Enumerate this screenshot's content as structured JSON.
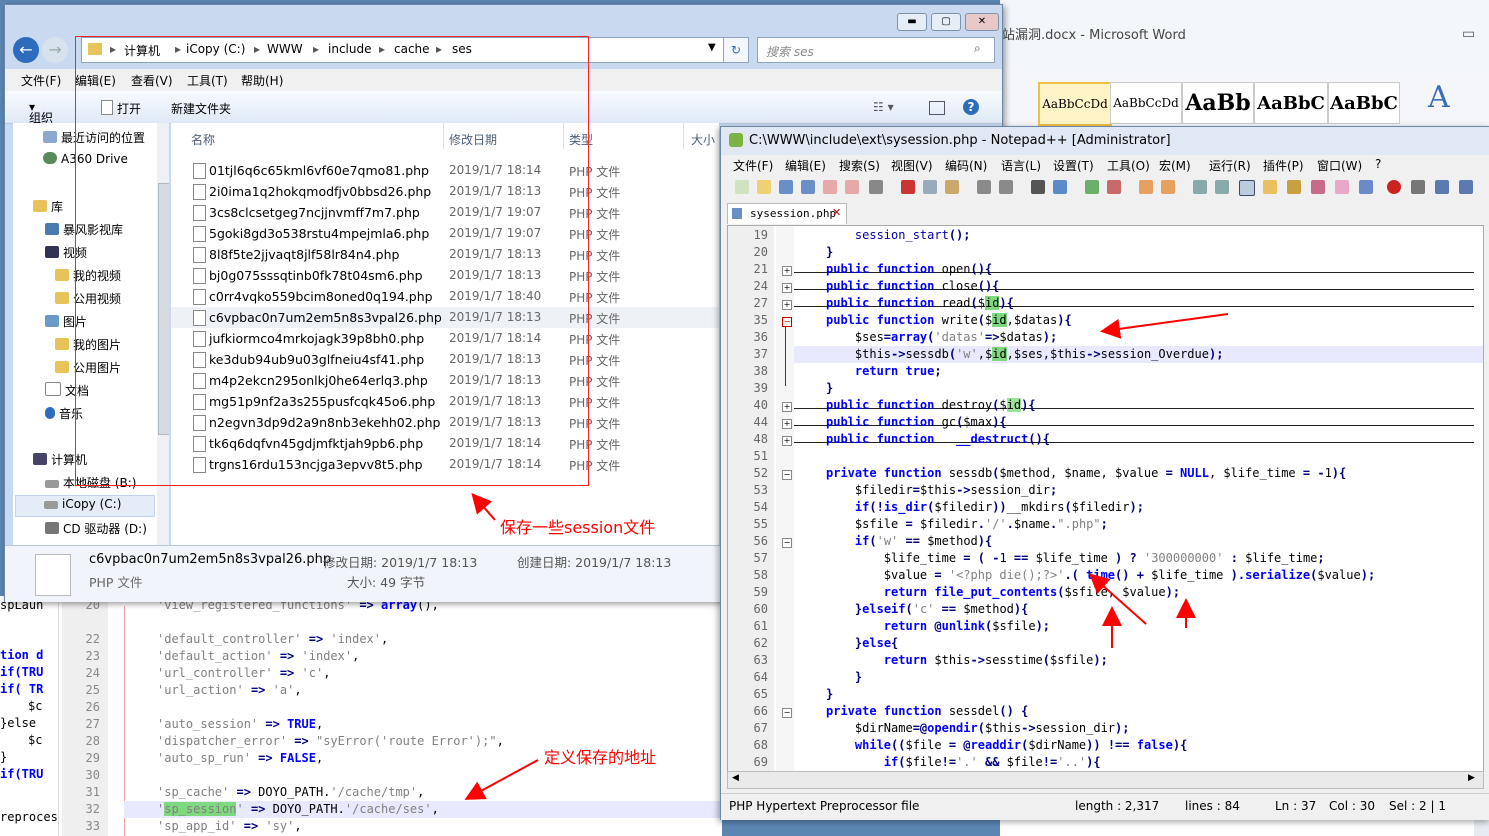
{
  "word": {
    "title": "站漏洞.docx - Microsoft Word",
    "styles": [
      "AaBbCcDd",
      "AaBbCcDd",
      "AaBb",
      "AaBbC",
      "AaBbC"
    ]
  },
  "explorer": {
    "breadcrumb": [
      "计算机",
      "iCopy (C:)",
      "WWW",
      "include",
      "cache",
      "ses"
    ],
    "search_placeholder": "搜索 ses",
    "menu": [
      "文件(F)",
      "编辑(E)",
      "查看(V)",
      "工具(T)",
      "帮助(H)"
    ],
    "toolbar": {
      "organize": "组织",
      "open": "打开",
      "new_folder": "新建文件夹"
    },
    "nav": [
      "最近访问的位置",
      "A360 Drive",
      "库",
      "暴风影视库",
      "视频",
      "我的视频",
      "公用视频",
      "图片",
      "我的图片",
      "公用图片",
      "文档",
      "音乐",
      "计算机",
      "本地磁盘 (B:)",
      "iCopy (C:)",
      "CD 驱动器 (D:)"
    ],
    "columns": {
      "name": "名称",
      "date": "修改日期",
      "type": "类型",
      "size": "大小"
    },
    "files": [
      {
        "name": "01tjl6q6c65kml6vf60e7qmo81.php",
        "date": "2019/1/7 18:14",
        "type": "PHP 文件"
      },
      {
        "name": "2i0ima1q2hokqmodfjv0bbsd26.php",
        "date": "2019/1/7 18:13",
        "type": "PHP 文件"
      },
      {
        "name": "3cs8clcsetgeg7ncjjnvmff7m7.php",
        "date": "2019/1/7 19:07",
        "type": "PHP 文件"
      },
      {
        "name": "5goki8gd3o538rstu4mpejmla6.php",
        "date": "2019/1/7 19:07",
        "type": "PHP 文件"
      },
      {
        "name": "8l8f5te2jjvaqt8jlf58lr84n4.php",
        "date": "2019/1/7 18:13",
        "type": "PHP 文件"
      },
      {
        "name": "bj0g075sssqtinb0fk78t04sm6.php",
        "date": "2019/1/7 18:13",
        "type": "PHP 文件"
      },
      {
        "name": "c0rr4vqko559bcim8oned0q194.php",
        "date": "2019/1/7 18:40",
        "type": "PHP 文件"
      },
      {
        "name": "c6vpbac0n7um2em5n8s3vpal26.php",
        "date": "2019/1/7 18:13",
        "type": "PHP 文件"
      },
      {
        "name": "jufkiormco4mrkojagk39p8bh0.php",
        "date": "2019/1/7 18:14",
        "type": "PHP 文件"
      },
      {
        "name": "ke3dub94ub9u03glfneiu4sf41.php",
        "date": "2019/1/7 18:13",
        "type": "PHP 文件"
      },
      {
        "name": "m4p2ekcn295onlkj0he64erlq3.php",
        "date": "2019/1/7 18:13",
        "type": "PHP 文件"
      },
      {
        "name": "mg51p9nf2a3s255pusfcqk45o6.php",
        "date": "2019/1/7 18:13",
        "type": "PHP 文件"
      },
      {
        "name": "n2egvn3dp9d2a9n8nb3ekehh02.php",
        "date": "2019/1/7 18:13",
        "type": "PHP 文件"
      },
      {
        "name": "tk6q6dqfvn45gdjmfktjah9pb6.php",
        "date": "2019/1/7 18:14",
        "type": "PHP 文件"
      },
      {
        "name": "trgns16rdu153ncjga3epvv8t5.php",
        "date": "2019/1/7 18:14",
        "type": "PHP 文件"
      }
    ],
    "details": {
      "filename": "c6vpbac0n7um2em5n8s3vpal26.php",
      "filetype": "PHP 文件",
      "modified": "修改日期: 2019/1/7 18:13",
      "created": "创建日期: 2019/1/7 18:13",
      "size": "大小: 49 字节"
    }
  },
  "npp": {
    "title": "C:\\WWW\\include\\ext\\sysession.php - Notepad++ [Administrator]",
    "menu": [
      "文件(F)",
      "编辑(E)",
      "搜索(S)",
      "视图(V)",
      "编码(N)",
      "语言(L)",
      "设置(T)",
      "工具(O)",
      "宏(M)",
      "运行(R)",
      "插件(P)",
      "窗口(W)",
      "?"
    ],
    "tab": "sysession.php",
    "status": {
      "filetype": "PHP Hypertext Preprocessor file",
      "length": "length : 2,317",
      "lines": "lines : 84",
      "ln": "Ln : 37",
      "col": "Col : 30",
      "sel": "Sel : 2 | 1"
    }
  },
  "annotations": {
    "session_files": "保存一些session文件",
    "save_path": "定义保存的地址"
  },
  "colors": {
    "annotation": "#ff0000",
    "highlight": "#7ed87e",
    "keyword": "#0000ff"
  }
}
